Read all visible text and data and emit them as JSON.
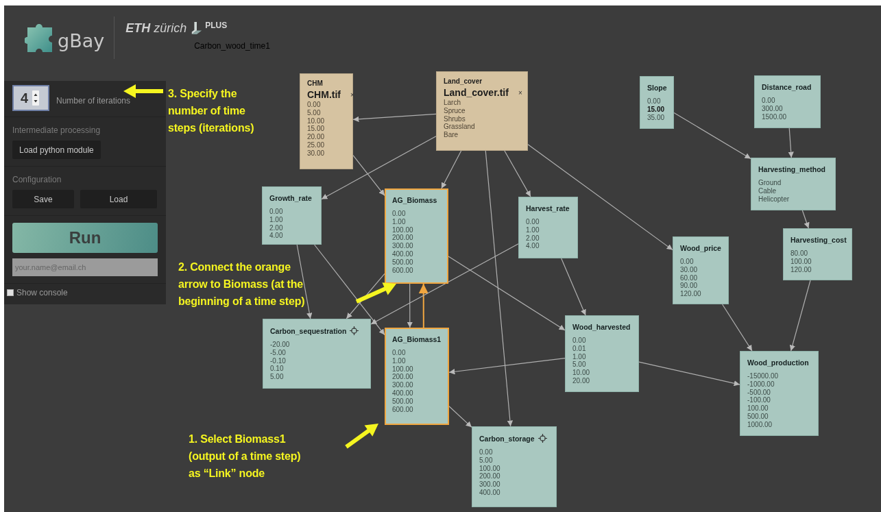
{
  "header": {
    "app_name": "gBay",
    "institution": "**ETH** zürich",
    "program": "PLUS",
    "model_name": "Carbon_wood_time1"
  },
  "sidebar": {
    "iterations": {
      "value": "4",
      "label": "Number of iterations"
    },
    "processing": {
      "title": "Intermediate processing",
      "button": "Load python module"
    },
    "configuration": {
      "title": "Configuration",
      "buttons": [
        "Save",
        "Load"
      ]
    },
    "run_button": "Run",
    "email": {
      "placeholder": "your.name@email.ch"
    },
    "console": {
      "label": "Show console",
      "checked": false
    }
  },
  "nodes": [
    {
      "kind": "file",
      "name": "CHM",
      "file": "CHM.tif",
      "remove": "×",
      "highlighted": false,
      "states": [
        {
          "label": "0.00",
          "selected": false
        },
        {
          "label": "5.00",
          "selected": false
        },
        {
          "label": "10.00",
          "selected": false
        },
        {
          "label": "15.00",
          "selected": false
        },
        {
          "label": "20.00",
          "selected": false
        },
        {
          "label": "25.00",
          "selected": false
        },
        {
          "label": "30.00",
          "selected": false
        }
      ]
    },
    {
      "kind": "file",
      "name": "Land_cover",
      "file": "Land_cover.tif",
      "remove": "×",
      "highlighted": false,
      "states": [
        {
          "label": "Larch",
          "selected": false
        },
        {
          "label": "Spruce",
          "selected": false
        },
        {
          "label": "Shrubs",
          "selected": false
        },
        {
          "label": "Grassland",
          "selected": false
        },
        {
          "label": "Bare",
          "selected": false
        }
      ]
    },
    {
      "kind": "variable",
      "name": "Slope",
      "highlighted": false,
      "target": false,
      "states": [
        {
          "label": "0.00",
          "selected": false
        },
        {
          "label": "15.00",
          "selected": true
        },
        {
          "label": "35.00",
          "selected": false
        }
      ]
    },
    {
      "kind": "variable",
      "name": "Distance_road",
      "highlighted": false,
      "target": false,
      "states": [
        {
          "label": "0.00",
          "selected": false
        },
        {
          "label": "300.00",
          "selected": false
        },
        {
          "label": "1500.00",
          "selected": false
        }
      ]
    },
    {
      "kind": "variable",
      "name": "Harvesting_method",
      "highlighted": false,
      "target": false,
      "states": [
        {
          "label": "Ground",
          "selected": false
        },
        {
          "label": "Cable",
          "selected": false
        },
        {
          "label": "Helicopter",
          "selected": false
        }
      ]
    },
    {
      "kind": "variable",
      "name": "Growth_rate",
      "highlighted": false,
      "target": false,
      "states": [
        {
          "label": "0.00",
          "selected": false
        },
        {
          "label": "1.00",
          "selected": false
        },
        {
          "label": "2.00",
          "selected": false
        },
        {
          "label": "4.00",
          "selected": false
        }
      ]
    },
    {
      "kind": "variable",
      "name": "AG_Biomass",
      "highlighted": true,
      "target": false,
      "states": [
        {
          "label": "0.00",
          "selected": false
        },
        {
          "label": "1.00",
          "selected": false
        },
        {
          "label": "100.00",
          "selected": false
        },
        {
          "label": "200.00",
          "selected": false
        },
        {
          "label": "300.00",
          "selected": false
        },
        {
          "label": "400.00",
          "selected": false
        },
        {
          "label": "500.00",
          "selected": false
        },
        {
          "label": "600.00",
          "selected": false
        }
      ]
    },
    {
      "kind": "variable",
      "name": "Harvest_rate",
      "highlighted": false,
      "target": false,
      "states": [
        {
          "label": "0.00",
          "selected": false
        },
        {
          "label": "1.00",
          "selected": false
        },
        {
          "label": "2.00",
          "selected": false
        },
        {
          "label": "4.00",
          "selected": false
        }
      ]
    },
    {
      "kind": "variable",
      "name": "Wood_price",
      "highlighted": false,
      "target": false,
      "states": [
        {
          "label": "0.00",
          "selected": false
        },
        {
          "label": "30.00",
          "selected": false
        },
        {
          "label": "60.00",
          "selected": false
        },
        {
          "label": "90.00",
          "selected": false
        },
        {
          "label": "120.00",
          "selected": false
        }
      ]
    },
    {
      "kind": "variable",
      "name": "Harvesting_cost",
      "highlighted": false,
      "target": false,
      "states": [
        {
          "label": "80.00",
          "selected": false
        },
        {
          "label": "100.00",
          "selected": false
        },
        {
          "label": "120.00",
          "selected": false
        }
      ]
    },
    {
      "kind": "variable",
      "name": "Carbon_sequestration",
      "highlighted": false,
      "target": true,
      "states": [
        {
          "label": "-20.00",
          "selected": false
        },
        {
          "label": "-5.00",
          "selected": false
        },
        {
          "label": "-0.10",
          "selected": false
        },
        {
          "label": "0.10",
          "selected": false
        },
        {
          "label": "5.00",
          "selected": false
        }
      ]
    },
    {
      "kind": "variable",
      "name": "AG_Biomass1",
      "highlighted": true,
      "target": false,
      "states": [
        {
          "label": "0.00",
          "selected": false
        },
        {
          "label": "1.00",
          "selected": false
        },
        {
          "label": "100.00",
          "selected": false
        },
        {
          "label": "200.00",
          "selected": false
        },
        {
          "label": "300.00",
          "selected": false
        },
        {
          "label": "400.00",
          "selected": false
        },
        {
          "label": "500.00",
          "selected": false
        },
        {
          "label": "600.00",
          "selected": false
        }
      ]
    },
    {
      "kind": "variable",
      "name": "Wood_harvested",
      "highlighted": false,
      "target": false,
      "states": [
        {
          "label": "0.00",
          "selected": false
        },
        {
          "label": "0.01",
          "selected": false
        },
        {
          "label": "1.00",
          "selected": false
        },
        {
          "label": "5.00",
          "selected": false
        },
        {
          "label": "10.00",
          "selected": false
        },
        {
          "label": "20.00",
          "selected": false
        }
      ]
    },
    {
      "kind": "variable",
      "name": "Wood_production",
      "highlighted": false,
      "target": false,
      "states": [
        {
          "label": "-15000.00",
          "selected": false
        },
        {
          "label": "-1000.00",
          "selected": false
        },
        {
          "label": "-500.00",
          "selected": false
        },
        {
          "label": "-100.00",
          "selected": false
        },
        {
          "label": "100.00",
          "selected": false
        },
        {
          "label": "500.00",
          "selected": false
        },
        {
          "label": "1000.00",
          "selected": false
        }
      ]
    },
    {
      "kind": "variable",
      "name": "Carbon_storage",
      "highlighted": false,
      "target": true,
      "states": [
        {
          "label": "0.00",
          "selected": false
        },
        {
          "label": "5.00",
          "selected": false
        },
        {
          "label": "100.00",
          "selected": false
        },
        {
          "label": "200.00",
          "selected": false
        },
        {
          "label": "300.00",
          "selected": false
        },
        {
          "label": "400.00",
          "selected": false
        }
      ]
    }
  ],
  "annotations": [
    {
      "lines": [
        "3. Specify the",
        "number of time",
        "steps (iterations)"
      ]
    },
    {
      "lines": [
        "2. Connect the orange",
        "arrow to Biomass (at the",
        "beginning of a time step)"
      ]
    },
    {
      "lines": [
        "1. Select Biomass1",
        "(output of a time step)",
        "as “Link” node"
      ]
    }
  ]
}
